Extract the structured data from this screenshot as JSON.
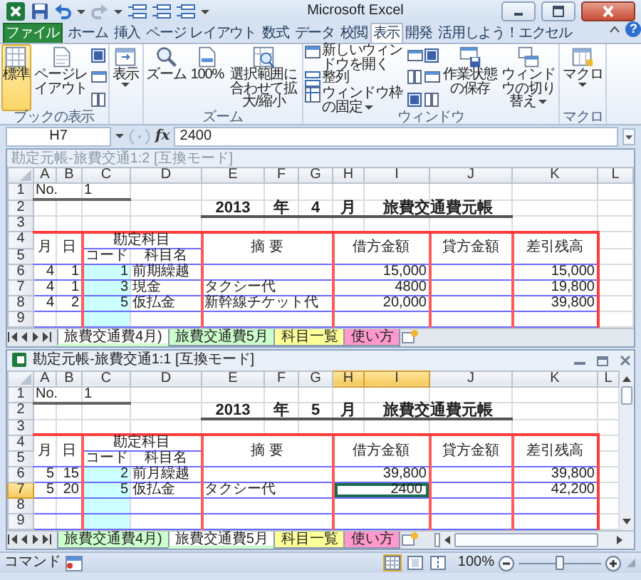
{
  "window": {
    "title": "Microsoft Excel"
  },
  "ribbon": {
    "tabs": [
      {
        "label": "ファイル",
        "kind": "file",
        "selected": false
      },
      {
        "label": "ホーム",
        "kind": "tab",
        "selected": false
      },
      {
        "label": "挿入",
        "kind": "tab",
        "selected": false
      },
      {
        "label": "ページ レイアウト",
        "kind": "tab",
        "selected": false
      },
      {
        "label": "数式",
        "kind": "tab",
        "selected": false
      },
      {
        "label": "データ",
        "kind": "tab",
        "selected": false
      },
      {
        "label": "校閲",
        "kind": "tab",
        "selected": false
      },
      {
        "label": "表示",
        "kind": "tab",
        "selected": true
      },
      {
        "label": "開発",
        "kind": "tab",
        "selected": false
      },
      {
        "label": "活用しよう！エクセル",
        "kind": "tab",
        "selected": false
      }
    ],
    "help": "?",
    "groups": [
      {
        "label": "ブックの表示",
        "items": [
          {
            "kind": "large",
            "label": "標準",
            "selected": true
          },
          {
            "kind": "large",
            "label": "ページレイアウト",
            "selected": false
          },
          {
            "kind": "icons"
          }
        ]
      },
      {
        "items": [
          {
            "kind": "large",
            "label": "表示",
            "dropdown": true
          }
        ]
      },
      {
        "label": "ズーム",
        "items": [
          {
            "kind": "large",
            "label": "ズーム"
          },
          {
            "kind": "large",
            "label": "100%"
          },
          {
            "kind": "large",
            "label": "選択範囲に合わせて拡大/縮小"
          }
        ]
      },
      {
        "label": "ウィンドウ",
        "items": [
          {
            "kind": "small",
            "label": "新しいウィンドウを開く"
          },
          {
            "kind": "small",
            "label": "整列"
          },
          {
            "kind": "small",
            "label": "ウィンドウ枠の固定",
            "dropdown": true
          },
          {
            "kind": "icons"
          },
          {
            "kind": "icons"
          },
          {
            "kind": "large",
            "label": "作業状態の保存"
          },
          {
            "kind": "large",
            "label": "ウィンドウの切り替え",
            "dropdown": true
          }
        ]
      },
      {
        "label": "マクロ",
        "items": [
          {
            "kind": "large",
            "label": "マクロ",
            "dropdown": true
          }
        ]
      }
    ]
  },
  "formula_bar": {
    "name_box": "H7",
    "function_label": "fx",
    "value": "2400"
  },
  "workbooks": [
    {
      "title": "勘定元帳-旅費交通1:2 [互換モード]",
      "active": false,
      "columns": [
        {
          "label": "A",
          "selected": false
        },
        {
          "label": "B",
          "selected": false
        },
        {
          "label": "C",
          "selected": false
        },
        {
          "label": "D",
          "selected": false
        },
        {
          "label": "E",
          "selected": false
        },
        {
          "label": "F",
          "selected": false
        },
        {
          "label": "G",
          "selected": false
        },
        {
          "label": "H",
          "selected": false
        },
        {
          "label": "I",
          "selected": false
        },
        {
          "label": "J",
          "selected": false
        },
        {
          "label": "K",
          "selected": false
        },
        {
          "label": "L",
          "selected": false
        }
      ],
      "rows": [
        {
          "label": "1",
          "selected": false
        },
        {
          "label": "2",
          "selected": false
        },
        {
          "label": "3",
          "selected": false
        },
        {
          "label": "4",
          "selected": false
        },
        {
          "label": "5",
          "selected": false
        },
        {
          "label": "6",
          "selected": false
        },
        {
          "label": "7",
          "selected": false
        },
        {
          "label": "8",
          "selected": false
        },
        {
          "label": "9",
          "selected": false
        }
      ],
      "sheet": {
        "number_label": "No.",
        "number": "1",
        "year": "2013",
        "year_unit": "年",
        "month": "4",
        "month_unit": "月",
        "title": "旅費交通費元帳",
        "headers": [
          "月",
          "日",
          "勘定科目",
          "コード",
          "科目名",
          "摘 要",
          "借方金額",
          "貸方金額",
          "差引残高"
        ],
        "entries": [
          {
            "month": "4",
            "day": "1",
            "code": "1",
            "account": "前期繰越",
            "debit": "15,000",
            "balance": "15,000",
            "active": false
          },
          {
            "month": "4",
            "day": "1",
            "code": "3",
            "account": "現金",
            "description": "タクシー代",
            "debit": "4800",
            "balance": "19,800",
            "active": false
          },
          {
            "month": "4",
            "day": "2",
            "code": "5",
            "account": "仮払金",
            "description": "新幹線チケット代",
            "debit": "20,000",
            "balance": "39,800",
            "active": false
          }
        ]
      },
      "sheet_tabs": [
        {
          "label": "旅費交通費4月)",
          "selected": true,
          "color": "#ccffcc"
        },
        {
          "label": "旅費交通費5月",
          "selected": false,
          "color": "#ccffcc"
        },
        {
          "label": "科目一覧",
          "selected": false,
          "color": "#ffff99"
        },
        {
          "label": "使い方",
          "selected": false,
          "color": "#ff99cc"
        }
      ]
    },
    {
      "title": "勘定元帳-旅費交通1:1 [互換モード]",
      "active": true,
      "columns": [
        {
          "label": "A",
          "selected": false
        },
        {
          "label": "B",
          "selected": false
        },
        {
          "label": "C",
          "selected": false
        },
        {
          "label": "D",
          "selected": false
        },
        {
          "label": "E",
          "selected": false
        },
        {
          "label": "F",
          "selected": false
        },
        {
          "label": "G",
          "selected": false
        },
        {
          "label": "H",
          "selected": true
        },
        {
          "label": "I",
          "selected": true
        },
        {
          "label": "J",
          "selected": false
        },
        {
          "label": "K",
          "selected": false
        },
        {
          "label": "L",
          "selected": false
        }
      ],
      "rows": [
        {
          "label": "1",
          "selected": false
        },
        {
          "label": "2",
          "selected": false
        },
        {
          "label": "3",
          "selected": false
        },
        {
          "label": "4",
          "selected": false
        },
        {
          "label": "5",
          "selected": false
        },
        {
          "label": "6",
          "selected": false
        },
        {
          "label": "7",
          "selected": true
        },
        {
          "label": "8",
          "selected": false
        },
        {
          "label": "9",
          "selected": false
        }
      ],
      "sheet": {
        "number_label": "No.",
        "number": "1",
        "year": "2013",
        "year_unit": "年",
        "month": "5",
        "month_unit": "月",
        "title": "旅費交通費元帳",
        "headers": [
          "月",
          "日",
          "勘定科目",
          "コード",
          "科目名",
          "摘 要",
          "借方金額",
          "貸方金額",
          "差引残高"
        ],
        "entries": [
          {
            "month": "5",
            "day": "15",
            "code": "2",
            "account": "前月繰越",
            "debit": "39,800",
            "balance": "39,800",
            "active": false
          },
          {
            "month": "5",
            "day": "20",
            "code": "5",
            "account": "仮払金",
            "description": "タクシー代",
            "debit": "2400",
            "balance": "42,200",
            "active": true
          }
        ]
      },
      "sheet_tabs": [
        {
          "label": "旅費交通費4月)",
          "selected": false,
          "color": "#ccffcc"
        },
        {
          "label": "旅費交通費5月",
          "selected": true,
          "color": "#ccffcc"
        },
        {
          "label": "科目一覧",
          "selected": false,
          "color": "#ffff99"
        },
        {
          "label": "使い方",
          "selected": false,
          "color": "#ff99cc"
        }
      ]
    }
  ],
  "status_bar": {
    "mode": "コマンド",
    "views": [
      {
        "selected": true
      },
      {
        "selected": false
      },
      {
        "selected": false
      }
    ],
    "zoom": "100%",
    "zoom_slider": {
      "level": 0.5
    }
  }
}
